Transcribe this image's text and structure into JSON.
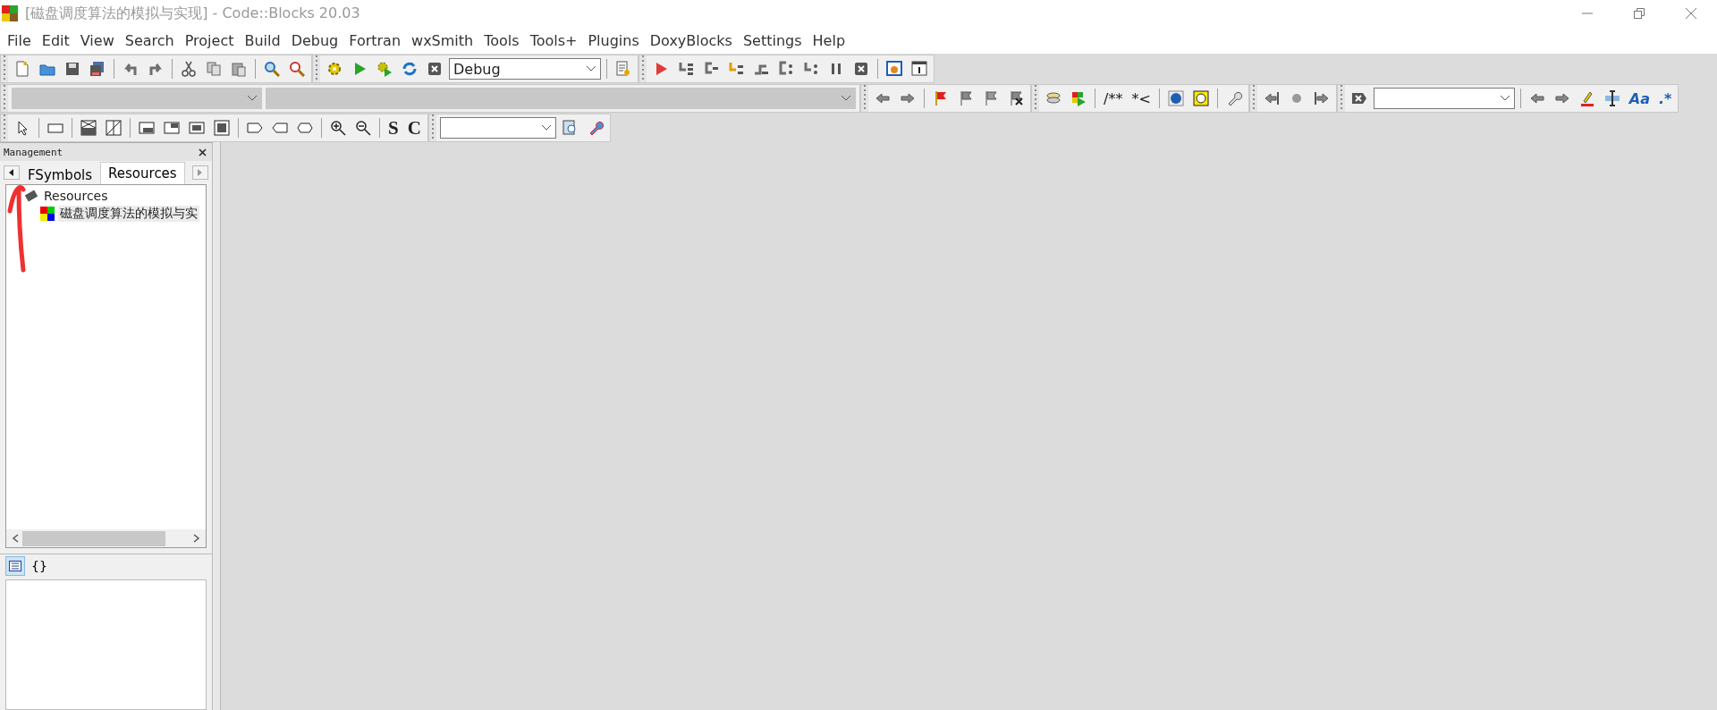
{
  "window": {
    "title": "[磁盘调度算法的模拟与实现] - Code::Blocks 20.03"
  },
  "menu": [
    "File",
    "Edit",
    "View",
    "Search",
    "Project",
    "Build",
    "Debug",
    "Fortran",
    "wxSmith",
    "Tools",
    "Tools+",
    "Plugins",
    "DoxyBlocks",
    "Settings",
    "Help"
  ],
  "build_target": {
    "value": "Debug"
  },
  "doxy_tools": [
    "/**",
    "*<"
  ],
  "wx_tools": [
    "S",
    "C"
  ],
  "search_tools": [
    "Aa",
    ".*"
  ],
  "management": {
    "title": "Management",
    "tabs": [
      {
        "label": "FSymbols",
        "selected": false
      },
      {
        "label": "Resources",
        "selected": true
      }
    ],
    "tree": [
      {
        "label": "Resources",
        "selected": false,
        "children": [
          {
            "label": "磁盘调度算法的模拟与实",
            "selected": true
          }
        ]
      }
    ],
    "bottom_tabs": [
      {
        "kind": "icon",
        "selected": true
      },
      {
        "kind": "text",
        "label": "{}",
        "selected": false
      }
    ]
  }
}
